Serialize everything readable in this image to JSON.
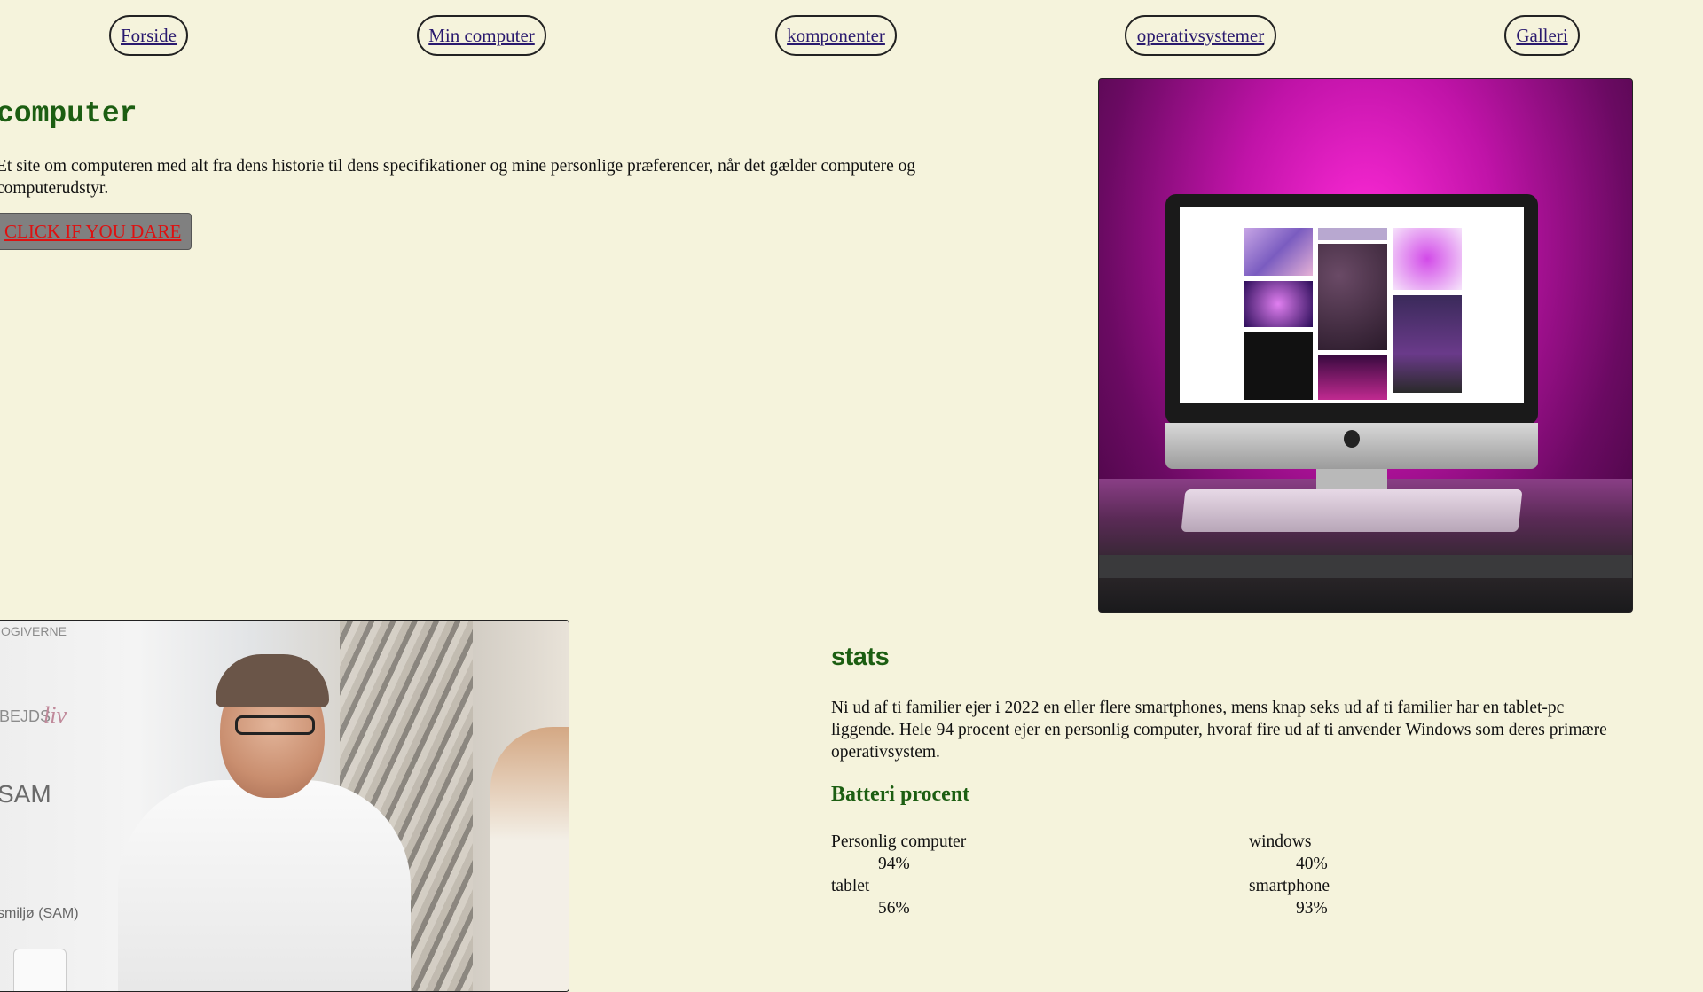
{
  "nav": {
    "items": [
      {
        "label": "Forside"
      },
      {
        "label": "Min computer"
      },
      {
        "label": "komponenter"
      },
      {
        "label": "operativsystemer"
      },
      {
        "label": "Galleri"
      }
    ]
  },
  "hero": {
    "title": "computer",
    "intro": "Et site om computeren med alt fra dens historie til dens specifikationer og mine personlige præferencer, når det gælder computere og computerudstyr.",
    "button_label": "CLICK IF YOU DARE"
  },
  "photo_person": {
    "banner_lines": [
      "OGIVERNE",
      "BEJDS",
      "liv",
      "SAM",
      "smiljø (SAM)"
    ]
  },
  "stats": {
    "title": "stats",
    "text": "Ni ud af ti familier ejer i 2022 en eller flere smartphones, mens knap seks ud af ti familier har en tablet-pc liggende. Hele 94 procent ejer en personlig computer, hvoraf fire ud af ti anvender Windows som deres primære operativsystem.",
    "battery_title": "Batteri procent",
    "items": [
      {
        "label": "Personlig computer",
        "value": "94%"
      },
      {
        "label": "windows",
        "value": "40%"
      },
      {
        "label": "tablet",
        "value": "56%"
      },
      {
        "label": "smartphone",
        "value": "93%"
      }
    ]
  },
  "colors": {
    "background": "#f5f3dc",
    "heading_green": "#1c5e12",
    "button_text": "#dd1111",
    "button_bg": "#808080",
    "link": "#2a1a6e"
  }
}
